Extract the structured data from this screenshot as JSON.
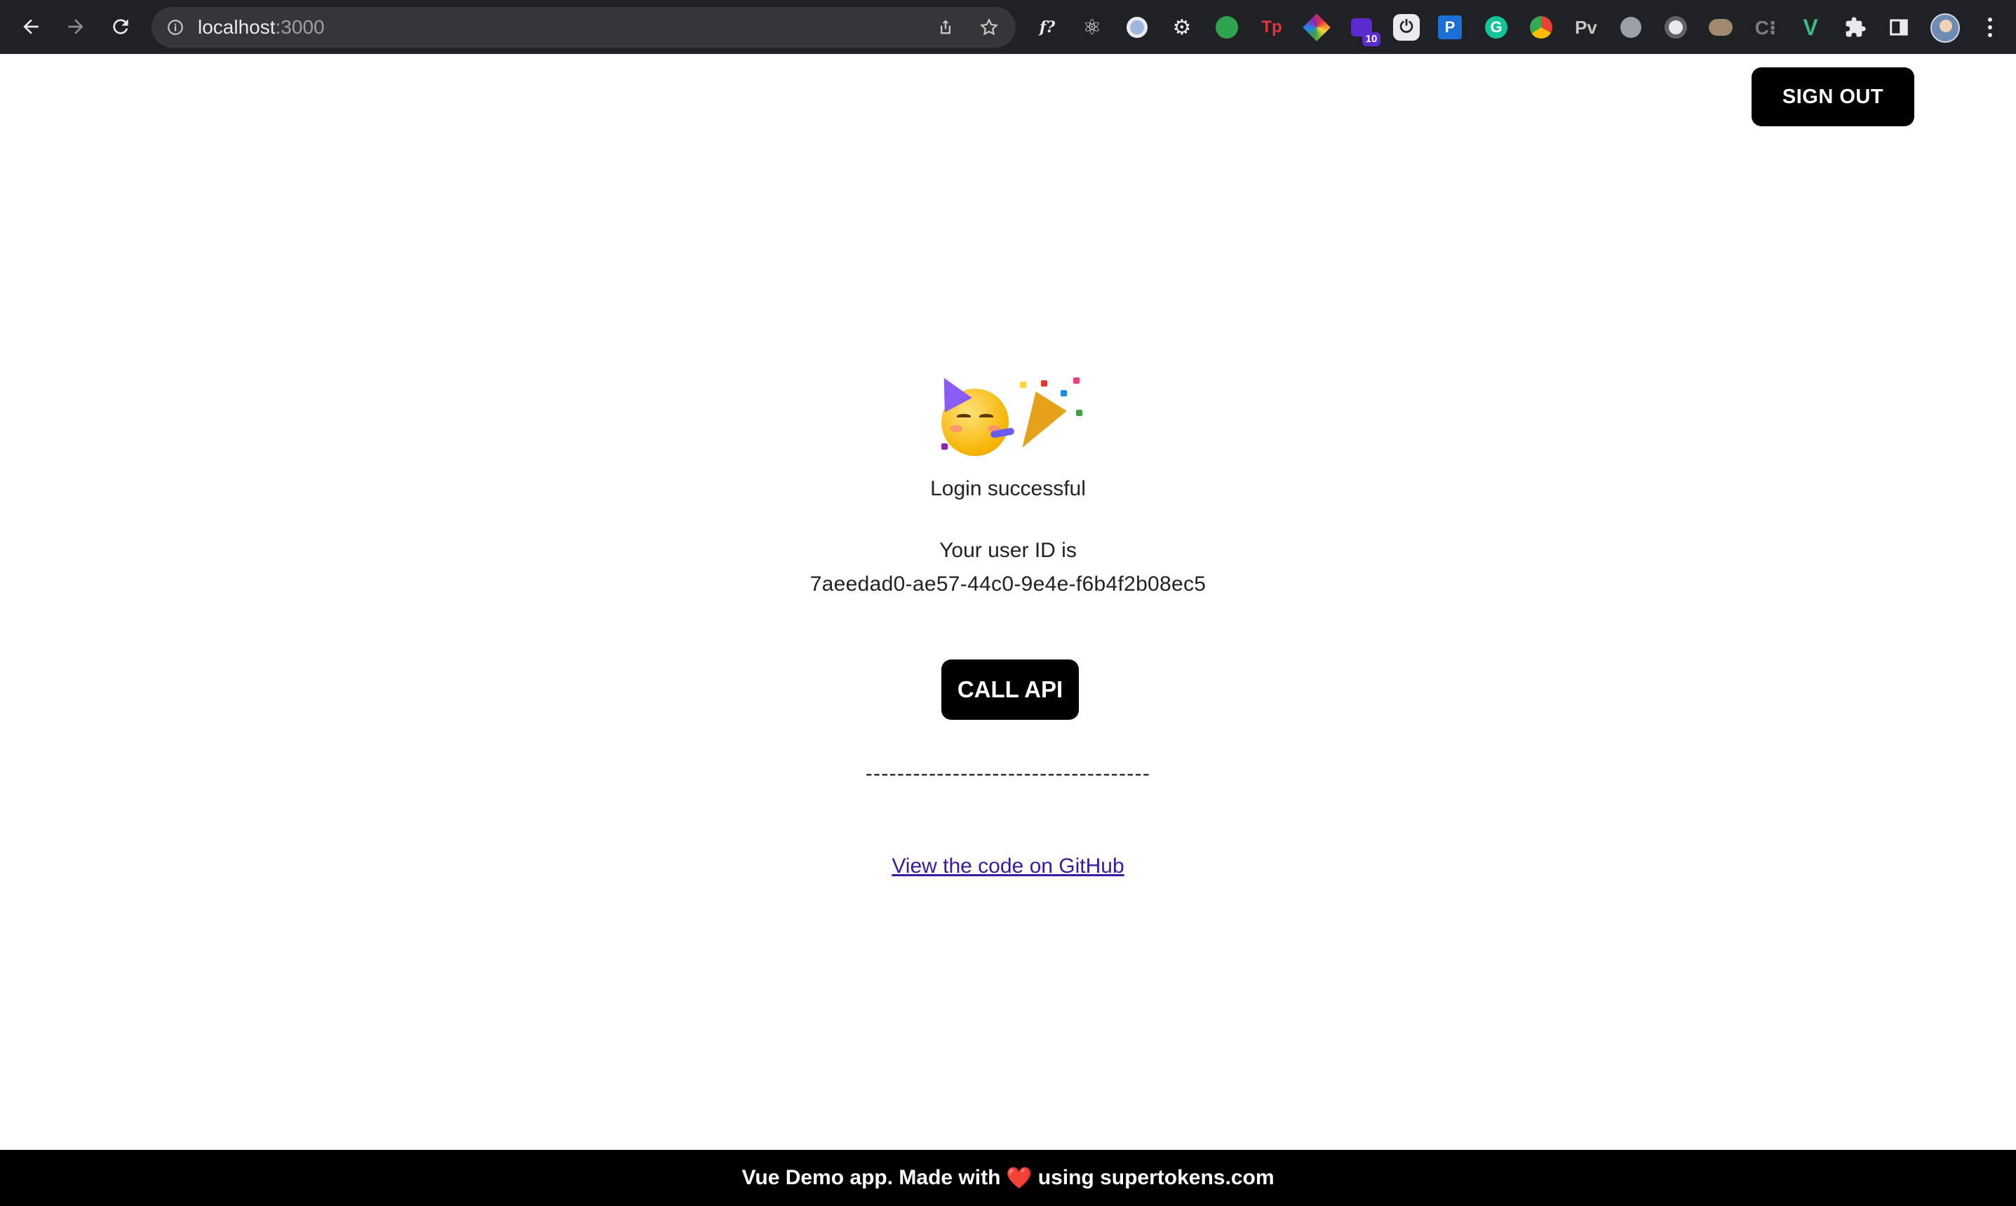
{
  "browser": {
    "url_host": "localhost",
    "url_port": ":3000",
    "extensions": [
      {
        "name": "formula-icon",
        "label": "f?"
      },
      {
        "name": "react-devtools-icon",
        "label": "⚛"
      },
      {
        "name": "circle-ext-icon",
        "label": ""
      },
      {
        "name": "gear-ext-icon",
        "label": "⚙"
      },
      {
        "name": "github-ext-icon",
        "label": ""
      },
      {
        "name": "tp-ext-icon",
        "label": "Tp"
      },
      {
        "name": "color-picker-ext-icon",
        "label": ""
      },
      {
        "name": "purple-ext-icon",
        "label": "",
        "badge": "10"
      },
      {
        "name": "power-ext-icon",
        "label": "⏻"
      },
      {
        "name": "p-ext-icon",
        "label": "P"
      },
      {
        "name": "grammarly-ext-icon",
        "label": "G"
      },
      {
        "name": "chrome-ext-icon",
        "label": ""
      },
      {
        "name": "pv-ext-icon",
        "label": "Pv"
      },
      {
        "name": "gray-dot-ext-icon",
        "label": ""
      },
      {
        "name": "network-ext-icon",
        "label": ""
      },
      {
        "name": "owl-ext-icon",
        "label": ""
      },
      {
        "name": "c-ext-icon",
        "label": "C⁝"
      },
      {
        "name": "vue-devtools-icon",
        "label": "V"
      },
      {
        "name": "puzzle-icon",
        "label": ""
      },
      {
        "name": "side-panel-icon",
        "label": ""
      }
    ]
  },
  "header": {
    "signout_label": "SIGN OUT"
  },
  "main": {
    "title": "Login successful",
    "user_id_label": "Your user ID is",
    "user_id": "7aeedad0-ae57-44c0-9e4e-f6b4f2b08ec5",
    "call_api_label": "CALL API",
    "separator": "------------------------------------",
    "github_link": "View the code on GitHub"
  },
  "footer": {
    "text_before": "Vue Demo app. Made with",
    "heart": "❤️",
    "text_after": "using supertokens.com"
  },
  "colors": {
    "button_bg": "#000000",
    "link": "#3a1aa0",
    "footer_bg": "#000000",
    "chrome_bg": "#202124"
  }
}
